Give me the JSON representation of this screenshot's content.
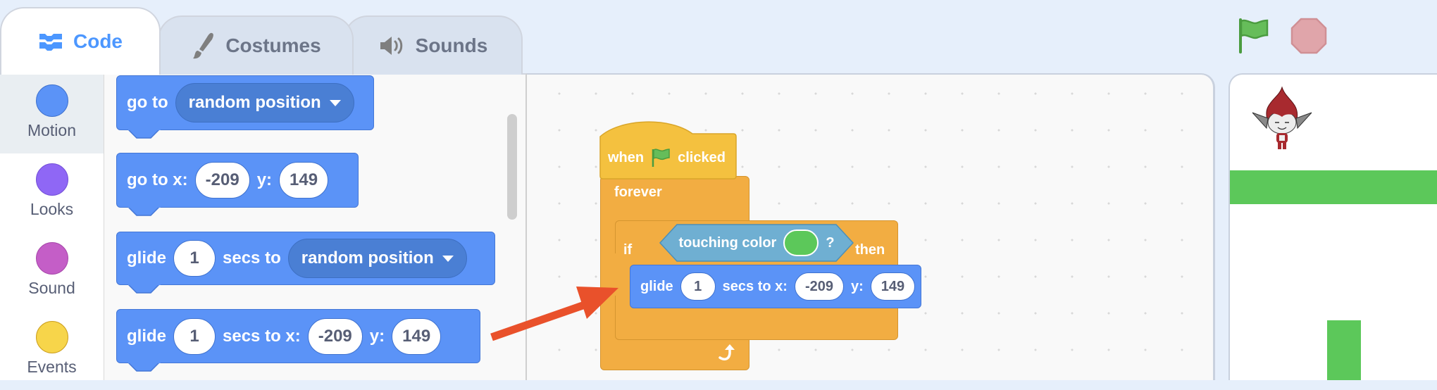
{
  "tabs": [
    {
      "id": "code",
      "label": "Code",
      "icon": "code-blocks-icon",
      "active": true
    },
    {
      "id": "costumes",
      "label": "Costumes",
      "icon": "paintbrush-icon",
      "active": false
    },
    {
      "id": "sounds",
      "label": "Sounds",
      "icon": "speaker-icon",
      "active": false
    }
  ],
  "controls": {
    "green_flag": "green-flag-icon",
    "stop": "stop-icon"
  },
  "categories": [
    {
      "label": "Motion",
      "color": "#4c97ff",
      "active": true
    },
    {
      "label": "Looks",
      "color": "#9966ff",
      "active": false
    },
    {
      "label": "Sound",
      "color": "#cf63cf",
      "active": false
    },
    {
      "label": "Events",
      "color": "#ffd53d",
      "active": false
    }
  ],
  "palette": {
    "blocks": [
      {
        "type": "go_to_menu",
        "prefix": "go to",
        "menu": "random position"
      },
      {
        "type": "go_to_xy",
        "prefix": "go to x:",
        "x": "-209",
        "ylabel": "y:",
        "y": "149"
      },
      {
        "type": "glide_menu",
        "prefix": "glide",
        "secs": "1",
        "mid": "secs to",
        "menu": "random position"
      },
      {
        "type": "glide_xy",
        "prefix": "glide",
        "secs": "1",
        "mid": "secs to x:",
        "x": "-209",
        "ylabel": "y:",
        "y": "149"
      }
    ]
  },
  "script": {
    "hat": {
      "before": "when",
      "after": "clicked"
    },
    "forever": {
      "label": "forever"
    },
    "if": {
      "label": "if",
      "then": "then"
    },
    "condition": {
      "label": "touching color",
      "question": "?",
      "color": "#5cc85a"
    },
    "glide": {
      "prefix": "glide",
      "secs": "1",
      "mid": "secs to x:",
      "x": "-209",
      "ylabel": "y:",
      "y": "149"
    }
  },
  "stage": {
    "sprite": "red-elf-sprite",
    "backdrop_color": "#ffffff",
    "wall_color": "#5cc85a"
  },
  "annotation": {
    "arrow_color": "#e9512b"
  }
}
